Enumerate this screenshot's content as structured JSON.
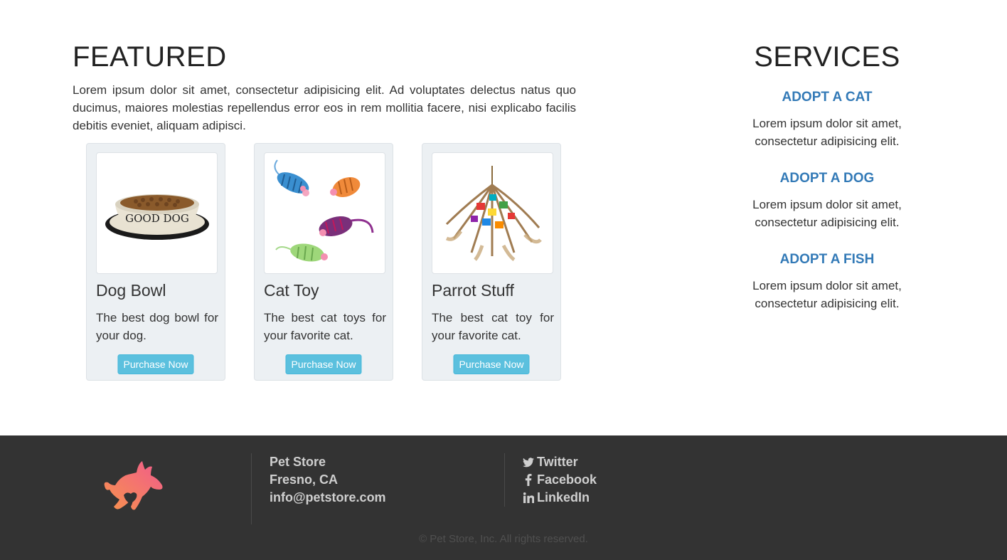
{
  "featured": {
    "heading": "FEATURED",
    "intro": "Lorem ipsum dolor sit amet, consectetur adipisicing elit. Ad voluptates delectus natus quo ducimus, maiores molestias repellendus error eos in rem mollitia facere, nisi explicabo facilis debitis eveniet, aliquam adipisci.",
    "products": [
      {
        "title": "Dog Bowl",
        "description": "The best dog bowl for your dog.",
        "button": "Purchase Now",
        "image_icon": "dog-bowl-image",
        "image_text": "GOOD DOG"
      },
      {
        "title": "Cat Toy",
        "description": "The best cat toys for your favorite cat.",
        "button": "Purchase Now",
        "image_icon": "cat-toy-mice-image"
      },
      {
        "title": "Parrot Stuff",
        "description": "The best cat toy for your favorite cat.",
        "button": "Purchase Now",
        "image_icon": "parrot-toy-image"
      }
    ]
  },
  "services": {
    "heading": "SERVICES",
    "items": [
      {
        "title": "ADOPT A CAT",
        "text": "Lorem ipsum dolor sit amet, consectetur adipisicing elit."
      },
      {
        "title": "ADOPT A DOG",
        "text": "Lorem ipsum dolor sit amet, consectetur adipisicing elit."
      },
      {
        "title": "ADOPT A FISH",
        "text": "Lorem ipsum dolor sit amet, consectetur adipisicing elit."
      }
    ]
  },
  "footer": {
    "logo_icon": "dog-logo-icon",
    "contact": {
      "name": "Pet Store",
      "city": "Fresno, CA",
      "email": "info@petstore.com"
    },
    "social": [
      {
        "label": "Twitter",
        "icon": "twitter-icon"
      },
      {
        "label": "Facebook",
        "icon": "facebook-icon"
      },
      {
        "label": "LinkedIn",
        "icon": "linkedin-icon"
      }
    ],
    "copyright": "© Pet Store, Inc. All rights reserved."
  },
  "colors": {
    "link_blue": "#337ab7",
    "button_cyan": "#5bc0de",
    "card_bg": "#ecf0f3",
    "footer_bg": "#333333",
    "logo_gradient_start": "#f7934c",
    "logo_gradient_end": "#f15b8c"
  }
}
